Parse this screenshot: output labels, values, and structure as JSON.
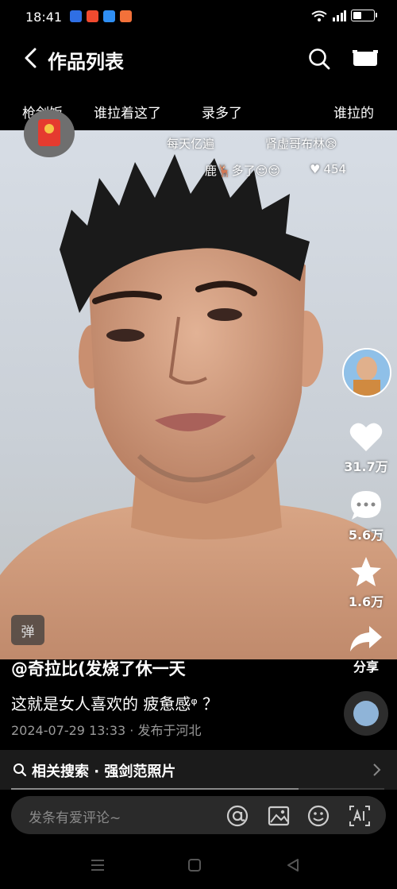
{
  "status_bar": {
    "time": "18:41",
    "app_icons": [
      {
        "name": "baidu-icon",
        "color": "#2f6fe4"
      },
      {
        "name": "video-icon",
        "color": "#f04a2f"
      },
      {
        "name": "browser-icon",
        "color": "#2f8ff4"
      },
      {
        "name": "shop-icon",
        "color": "#f3713a"
      }
    ],
    "battery_level": 0.45
  },
  "header": {
    "title": "作品列表"
  },
  "tags": [
    "枪剑饭",
    "谁拉着这了",
    "录多了",
    "谁拉的"
  ],
  "overlay_comments": {
    "c1": "每天亿遍",
    "c2": "肾虚哥布林😪",
    "c3": "鹿🦌多了😌😌",
    "c3_likes": "454"
  },
  "right_rail": {
    "likes": "31.7万",
    "comments": "5.6万",
    "favorites": "1.6万",
    "share": "分享"
  },
  "watermark": "弹",
  "caption": {
    "author": "@奇拉比(发烧了休一天",
    "description": "这就是女人喜欢的 疲惫感ᵠ ？",
    "meta": "2024-07-29 13:33 · 发布于河北"
  },
  "related_search": {
    "text": "相关搜索 · 强剑范照片",
    "progress": 0.77
  },
  "comment_input": {
    "placeholder": "发条有爱评论~"
  },
  "colors": {
    "background": "#000000",
    "input_bg": "#2a2a2a",
    "red_envelope": "#e53b2f"
  }
}
